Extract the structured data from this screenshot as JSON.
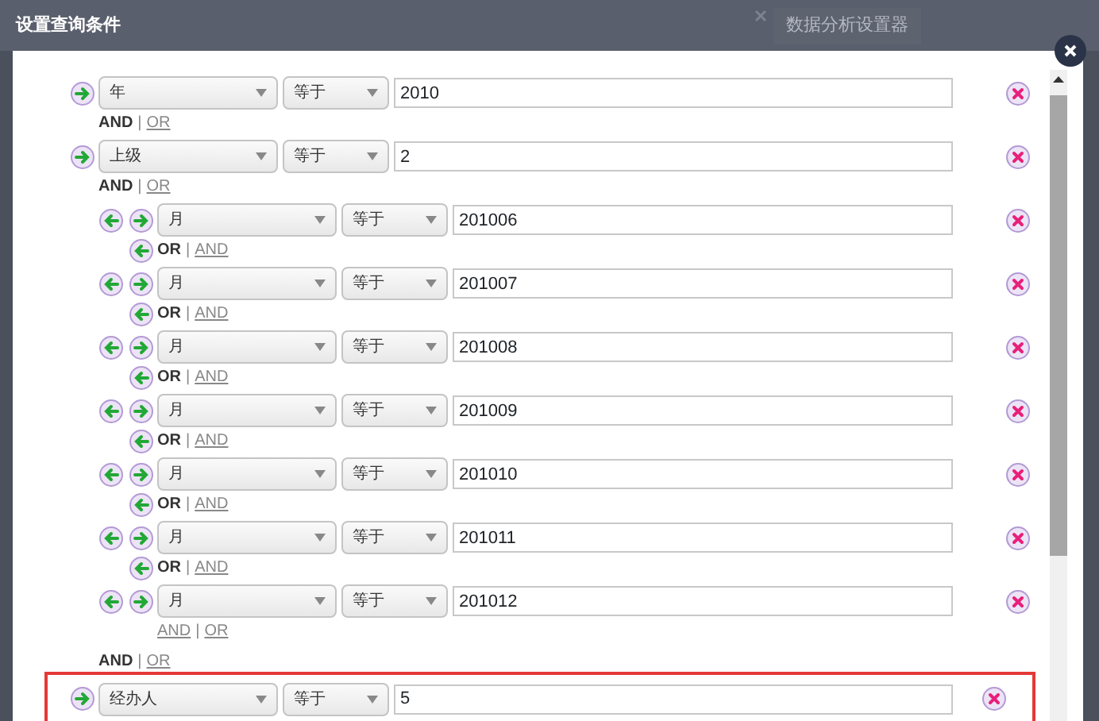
{
  "dialog": {
    "title": "设置查询条件",
    "background_tab": "数据分析设置器"
  },
  "conditions": [
    {
      "field": "年",
      "operator": "等于",
      "value": "2010",
      "highlighted": false,
      "connector": {
        "arrow": false,
        "separator": "|",
        "options": [
          {
            "label": "AND",
            "selected": true
          },
          {
            "label": "OR",
            "selected": false
          }
        ]
      }
    },
    {
      "field": "上级",
      "operator": "等于",
      "value": "2",
      "highlighted": false,
      "connector": {
        "arrow": false,
        "separator": "|",
        "options": [
          {
            "label": "AND",
            "selected": true
          },
          {
            "label": "OR",
            "selected": false
          }
        ]
      },
      "children": [
        {
          "field": "月",
          "operator": "等于",
          "value": "201006",
          "highlighted": false,
          "connector": {
            "arrow": true,
            "separator": "|",
            "options": [
              {
                "label": "OR",
                "selected": true
              },
              {
                "label": "AND",
                "selected": false
              }
            ]
          }
        },
        {
          "field": "月",
          "operator": "等于",
          "value": "201007",
          "highlighted": false,
          "connector": {
            "arrow": true,
            "separator": "|",
            "options": [
              {
                "label": "OR",
                "selected": true
              },
              {
                "label": "AND",
                "selected": false
              }
            ]
          }
        },
        {
          "field": "月",
          "operator": "等于",
          "value": "201008",
          "highlighted": false,
          "connector": {
            "arrow": true,
            "separator": "|",
            "options": [
              {
                "label": "OR",
                "selected": true
              },
              {
                "label": "AND",
                "selected": false
              }
            ]
          }
        },
        {
          "field": "月",
          "operator": "等于",
          "value": "201009",
          "highlighted": false,
          "connector": {
            "arrow": true,
            "separator": "|",
            "options": [
              {
                "label": "OR",
                "selected": true
              },
              {
                "label": "AND",
                "selected": false
              }
            ]
          }
        },
        {
          "field": "月",
          "operator": "等于",
          "value": "201010",
          "highlighted": false,
          "connector": {
            "arrow": true,
            "separator": "|",
            "options": [
              {
                "label": "OR",
                "selected": true
              },
              {
                "label": "AND",
                "selected": false
              }
            ]
          }
        },
        {
          "field": "月",
          "operator": "等于",
          "value": "201011",
          "highlighted": false,
          "connector": {
            "arrow": true,
            "separator": "|",
            "options": [
              {
                "label": "OR",
                "selected": true
              },
              {
                "label": "AND",
                "selected": false
              }
            ]
          }
        },
        {
          "field": "月",
          "operator": "等于",
          "value": "201012",
          "highlighted": false,
          "connector": {
            "arrow": false,
            "separator": "|",
            "options": [
              {
                "label": "AND",
                "selected": false
              },
              {
                "label": "OR",
                "selected": false
              }
            ]
          }
        }
      ],
      "group_connector": {
        "arrow": false,
        "separator": "|",
        "options": [
          {
            "label": "AND",
            "selected": true
          },
          {
            "label": "OR",
            "selected": false
          }
        ]
      }
    },
    {
      "field": "经办人",
      "operator": "等于",
      "value": "5",
      "highlighted": true
    }
  ]
}
